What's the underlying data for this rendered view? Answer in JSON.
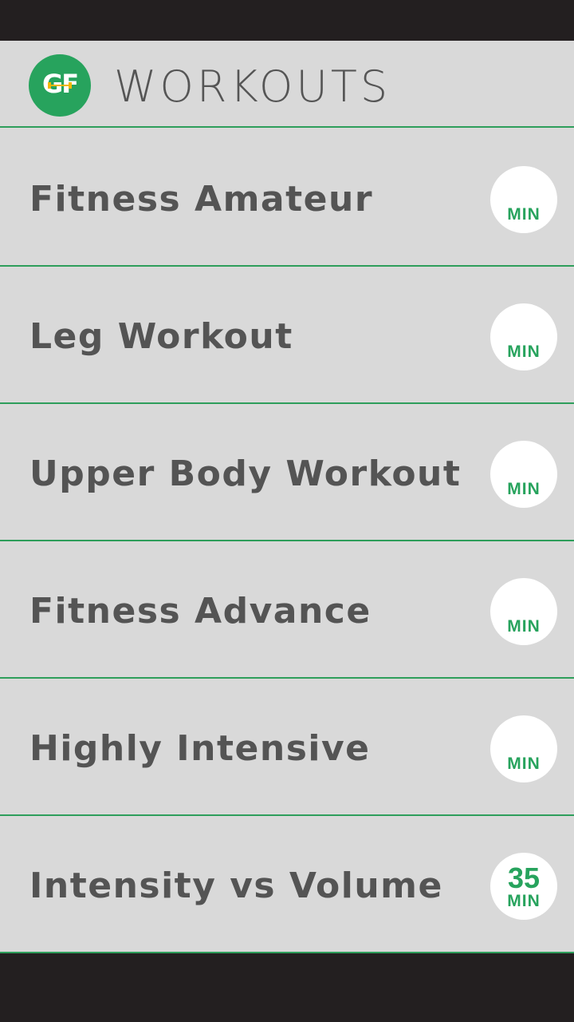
{
  "header": {
    "logo_text": "GF",
    "title": "WORKOUTS"
  },
  "colors": {
    "accent": "#27a35d",
    "divider": "#2e9e5b",
    "background": "#d9d9d9",
    "text": "#545454",
    "system_bar": "#231f20"
  },
  "workouts": [
    {
      "title": "Fitness Amateur",
      "duration": "",
      "unit": "MIN"
    },
    {
      "title": "Leg Workout",
      "duration": "",
      "unit": "MIN"
    },
    {
      "title": "Upper Body Workout",
      "duration": "",
      "unit": "MIN"
    },
    {
      "title": "Fitness Advance",
      "duration": "",
      "unit": "MIN"
    },
    {
      "title": "Highly Intensive",
      "duration": "",
      "unit": "MIN"
    },
    {
      "title": "Intensity vs Volume",
      "duration": "35",
      "unit": "MIN"
    }
  ]
}
